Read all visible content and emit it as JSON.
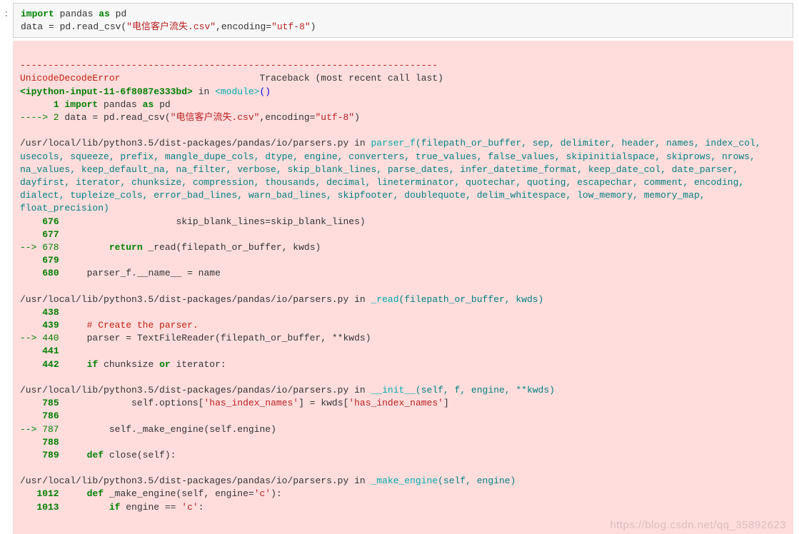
{
  "input_cell": {
    "kw_import": "import",
    "kw_as": "as",
    "mod_pandas": "pandas",
    "alias_pd": "pd",
    "line2_pre": "data = pd.read_csv(",
    "line2_str1": "\"电信客户流失.csv\"",
    "line2_mid": ",encoding=",
    "line2_str2": "\"utf-8\"",
    "line2_end": ")"
  },
  "traceback": {
    "separator": "---------------------------------------------------------------------------",
    "err_header_name": "UnicodeDecodeError",
    "err_header_rest": "                         Traceback (most recent call last)",
    "ipy_frame_pre": "<ipython-input-11-6f8087e333bd>",
    "ipy_in": " in ",
    "ipy_mod": "<module>",
    "ipy_paren": "()",
    "ipy_l1_num": "      1 ",
    "ipy_l1_kw_import": "import",
    "ipy_l1_mid": " pandas ",
    "ipy_l1_kw_as": "as",
    "ipy_l1_tail": " pd",
    "ipy_l2_arrow": "----> 2 ",
    "ipy_l2_pre": "data = pd.read_csv(",
    "ipy_l2_str1": "\"电信客户流失.csv\"",
    "ipy_l2_mid": ",encoding=",
    "ipy_l2_str2": "\"utf-8\"",
    "ipy_l2_end": ")",
    "frame1_path": "/usr/local/lib/python3.5/dist-packages/pandas/io/parsers.py",
    "frame1_in": " in ",
    "frame1_fn": "parser_f",
    "frame1_sig": "(filepath_or_buffer, sep, delimiter, header, names, index_col, usecols, squeeze, prefix, mangle_dupe_cols, dtype, engine, converters, true_values, false_values, skipinitialspace, skiprows, nrows, na_values, keep_default_na, na_filter, verbose, skip_blank_lines, parse_dates, infer_datetime_format, keep_date_col, date_parser, dayfirst, iterator, chunksize, compression, thousands, decimal, lineterminator, quotechar, quoting, escapechar, comment, encoding, dialect, tupleize_cols, error_bad_lines, warn_bad_lines, skipfooter, doublequote, delim_whitespace, low_memory, memory_map, float_precision)",
    "f1_l676_num": "    676 ",
    "f1_l676_code": "                    skip_blank_lines=skip_blank_lines)",
    "f1_l677_num": "    677 ",
    "f1_l678_arrow": "--> 678 ",
    "f1_l678_pre": "        ",
    "f1_l678_kw": "return",
    "f1_l678_mid": " _read(filepath_or_buffer, kwds)",
    "f1_l679_num": "    679 ",
    "f1_l680_num": "    680 ",
    "f1_l680_code": "    parser_f.__name__ = name",
    "frame2_path": "/usr/local/lib/python3.5/dist-packages/pandas/io/parsers.py",
    "frame2_in": " in ",
    "frame2_fn": "_read",
    "frame2_sig": "(filepath_or_buffer, kwds)",
    "f2_l438_num": "    438 ",
    "f2_l439_num": "    439 ",
    "f2_l439_comment": "    # Create the parser.",
    "f2_l440_arrow": "--> 440 ",
    "f2_l440_code": "    parser = TextFileReader(filepath_or_buffer, **kwds)",
    "f2_l441_num": "    441 ",
    "f2_l442_num": "    442 ",
    "f2_l442_pre": "    ",
    "f2_l442_kw_if": "if",
    "f2_l442_mid1": " chunksize ",
    "f2_l442_kw_or": "or",
    "f2_l442_mid2": " iterator:",
    "frame3_path": "/usr/local/lib/python3.5/dist-packages/pandas/io/parsers.py",
    "frame3_in": " in ",
    "frame3_fn": "__init__",
    "frame3_sig": "(self, f, engine, **kwds)",
    "f3_l785_num": "    785 ",
    "f3_l785_pre": "            self.options[",
    "f3_l785_str1": "'has_index_names'",
    "f3_l785_mid": "] = kwds[",
    "f3_l785_str2": "'has_index_names'",
    "f3_l785_end": "]",
    "f3_l786_num": "    786 ",
    "f3_l787_arrow": "--> 787 ",
    "f3_l787_code": "        self._make_engine(self.engine)",
    "f3_l788_num": "    788 ",
    "f3_l789_num": "    789 ",
    "f3_l789_pre": "    ",
    "f3_l789_kw": "def",
    "f3_l789_mid": " close(self):",
    "frame4_path": "/usr/local/lib/python3.5/dist-packages/pandas/io/parsers.py",
    "frame4_in": " in ",
    "frame4_fn": "_make_engine",
    "frame4_sig": "(self, engine)",
    "f4_l1012_num": "   1012 ",
    "f4_l1012_pre": "    ",
    "f4_l1012_kw": "def",
    "f4_l1012_mid": " _make_engine(self, engine=",
    "f4_l1012_str": "'c'",
    "f4_l1012_end": "):",
    "f4_l1013_num": "   1013 ",
    "f4_l1013_pre": "        ",
    "f4_l1013_kw": "if",
    "f4_l1013_mid": " engine == ",
    "f4_l1013_str": "'c'",
    "f4_l1013_end": ":"
  },
  "watermark": "https://blog.csdn.net/qq_35892623"
}
